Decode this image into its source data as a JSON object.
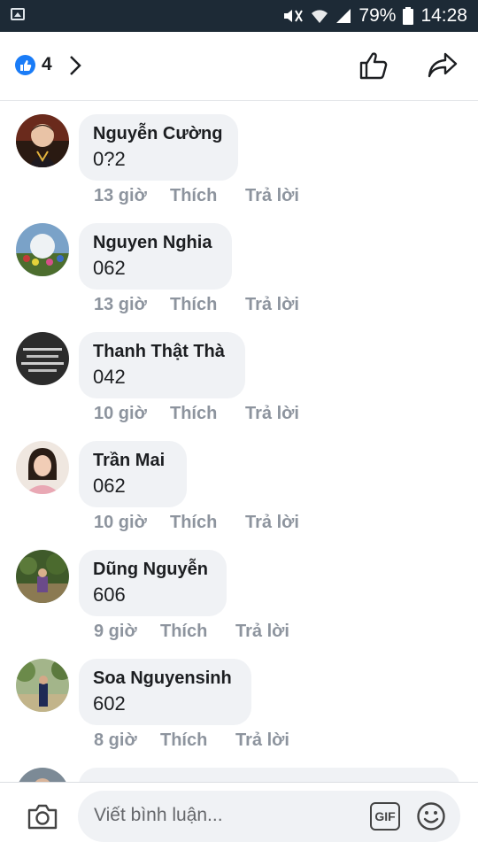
{
  "status_bar": {
    "battery_percent": "79%",
    "time": "14:28"
  },
  "header": {
    "like_count": "4"
  },
  "comments": [
    {
      "name": "Nguyễn Cường",
      "text": "0?2",
      "time": "13 giờ",
      "like": "Thích",
      "reply": "Trả lời"
    },
    {
      "name": "Nguyen Nghia",
      "text": "062",
      "time": "13 giờ",
      "like": "Thích",
      "reply": "Trả lời"
    },
    {
      "name": "Thanh Thật Thà",
      "text": "042",
      "time": "10 giờ",
      "like": "Thích",
      "reply": "Trả lời"
    },
    {
      "name": "Trần Mai",
      "text": "062",
      "time": "10 giờ",
      "like": "Thích",
      "reply": "Trả lời"
    },
    {
      "name": "Dũng Nguyễn",
      "text": "606",
      "time": "9 giờ",
      "like": "Thích",
      "reply": "Trả lời"
    },
    {
      "name": "Soa Nguyensinh",
      "text": "602",
      "time": "8 giờ",
      "like": "Thích",
      "reply": "Trả lời"
    }
  ],
  "footer": {
    "placeholder": "Viết bình luận...",
    "gif_label": "GIF"
  },
  "colors": {
    "accent": "#1a7cf7",
    "bubble": "#f0f2f5",
    "meta": "#8d949e"
  }
}
